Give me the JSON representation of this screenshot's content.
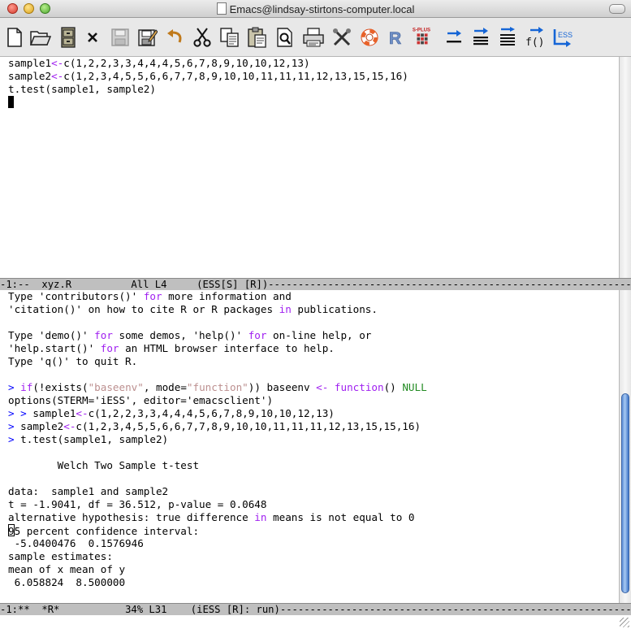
{
  "window": {
    "title": "Emacs@lindsay-stirtons-computer.local"
  },
  "toolbar": {
    "items": [
      {
        "icon": "new-file-icon"
      },
      {
        "icon": "open-folder-icon"
      },
      {
        "icon": "dired-cabinet-icon"
      },
      {
        "icon": "close-x-icon"
      },
      {
        "icon": "save-disabled-icon"
      },
      {
        "icon": "save-as-icon"
      },
      {
        "icon": "undo-icon"
      },
      {
        "icon": "cut-icon"
      },
      {
        "icon": "copy-icon"
      },
      {
        "icon": "paste-icon"
      },
      {
        "icon": "search-icon"
      },
      {
        "icon": "print-icon"
      },
      {
        "icon": "preferences-icon"
      },
      {
        "icon": "help-lifebuoy-icon"
      },
      {
        "icon": "r-logo-icon"
      },
      {
        "icon": "splus-icon",
        "label": "S-PLUS"
      },
      {
        "icon": "eval-line-icon"
      },
      {
        "icon": "eval-region-icon"
      },
      {
        "icon": "eval-buffer-icon"
      },
      {
        "icon": "eval-function-icon",
        "label": "f()"
      },
      {
        "icon": "ess-switch-icon",
        "label": "ESS"
      }
    ]
  },
  "editor": {
    "lines": [
      "sample1<-c(1,2,2,3,3,4,4,4,5,6,7,8,9,10,10,12,13)",
      "sample2<-c(1,2,3,4,5,5,6,6,7,7,8,9,10,10,11,11,11,12,13,15,15,16)",
      "t.test(sample1, sample2)"
    ],
    "modeline": "-1:--  xyz.R          All L4     (ESS[S] [R])--------------------------------------------------------------------"
  },
  "console": {
    "lines": {
      "l1": "Type 'contributors()' for more information and",
      "l2": "'citation()' on how to cite R or R packages in publications.",
      "l3": "",
      "l4": "Type 'demo()' for some demos, 'help()' for on-line help, or",
      "l5": "'help.start()' for an HTML browser interface to help.",
      "l6": "Type 'q()' to quit R.",
      "l7": "",
      "l8": "> if(!exists(\"baseenv\", mode=\"function\")) baseenv <- function() NULL",
      "l9": "options(STERM='iESS', editor='emacsclient')",
      "l10": "> > sample1<-c(1,2,2,3,3,4,4,4,5,6,7,8,9,10,10,12,13)",
      "l11": "> sample2<-c(1,2,3,4,5,5,6,6,7,7,8,9,10,10,11,11,11,12,13,15,15,16)",
      "l12": "> t.test(sample1, sample2)",
      "l13": "",
      "l14": "        Welch Two Sample t-test",
      "l15": "",
      "l16": "data:  sample1 and sample2",
      "l17": "t = -1.9041, df = 36.512, p-value = 0.0648",
      "l18": "alternative hypothesis: true difference in means is not equal to 0",
      "l19": "95 percent confidence interval:",
      "l20": " -5.0400476  0.1576946",
      "l21": "sample estimates:",
      "l22": "mean of x mean of y",
      "l23": " 6.058824  8.500000"
    },
    "modeline": "-1:**  *R*           34% L31    (iESS [R]: run)-------------------------------------------------------------------"
  },
  "scroll": {
    "console_thumb_start": 0.33,
    "console_thumb_end": 0.97
  },
  "colors": {
    "keyword": "#a020f0",
    "string": "#bc8f8f",
    "constant": "#228b22",
    "prompt": "#0000ff",
    "modeline_bg": "#bfbfbf",
    "scroll_thumb": "#5d8ed6"
  }
}
